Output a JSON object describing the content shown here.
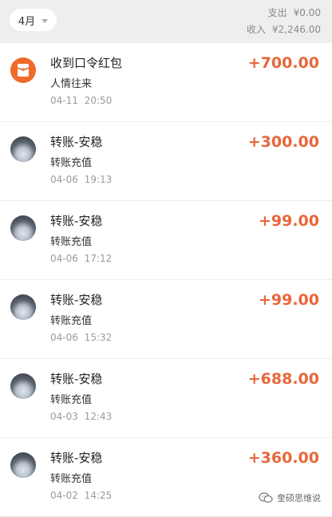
{
  "header": {
    "month": "4月",
    "expense_label": "支出",
    "expense_value": "¥0.00",
    "income_label": "收入",
    "income_value": "¥2,246.00"
  },
  "transactions": [
    {
      "icon": "red-packet-icon",
      "title": "收到口令红包",
      "subtitle": "人情往来",
      "time": "04-11  20:50",
      "amount": "+700.00"
    },
    {
      "icon": "avatar",
      "title": "转账-安稳",
      "subtitle": "转账充值",
      "time": "04-06  19:13",
      "amount": "+300.00"
    },
    {
      "icon": "avatar",
      "title": "转账-安稳",
      "subtitle": "转账充值",
      "time": "04-06  17:12",
      "amount": "+99.00"
    },
    {
      "icon": "avatar",
      "title": "转账-安稳",
      "subtitle": "转账充值",
      "time": "04-06  15:32",
      "amount": "+99.00"
    },
    {
      "icon": "avatar",
      "title": "转账-安稳",
      "subtitle": "转账充值",
      "time": "04-03  12:43",
      "amount": "+688.00"
    },
    {
      "icon": "avatar",
      "title": "转账-安稳",
      "subtitle": "转账充值",
      "time": "04-02  14:25",
      "amount": "+360.00"
    }
  ],
  "colors": {
    "accent": "#e8673a",
    "header_bg": "#eeeeee",
    "red_packet": "#f06b2c"
  },
  "watermark": {
    "text": "奎硕思维说",
    "icon": "wechat-icon"
  }
}
